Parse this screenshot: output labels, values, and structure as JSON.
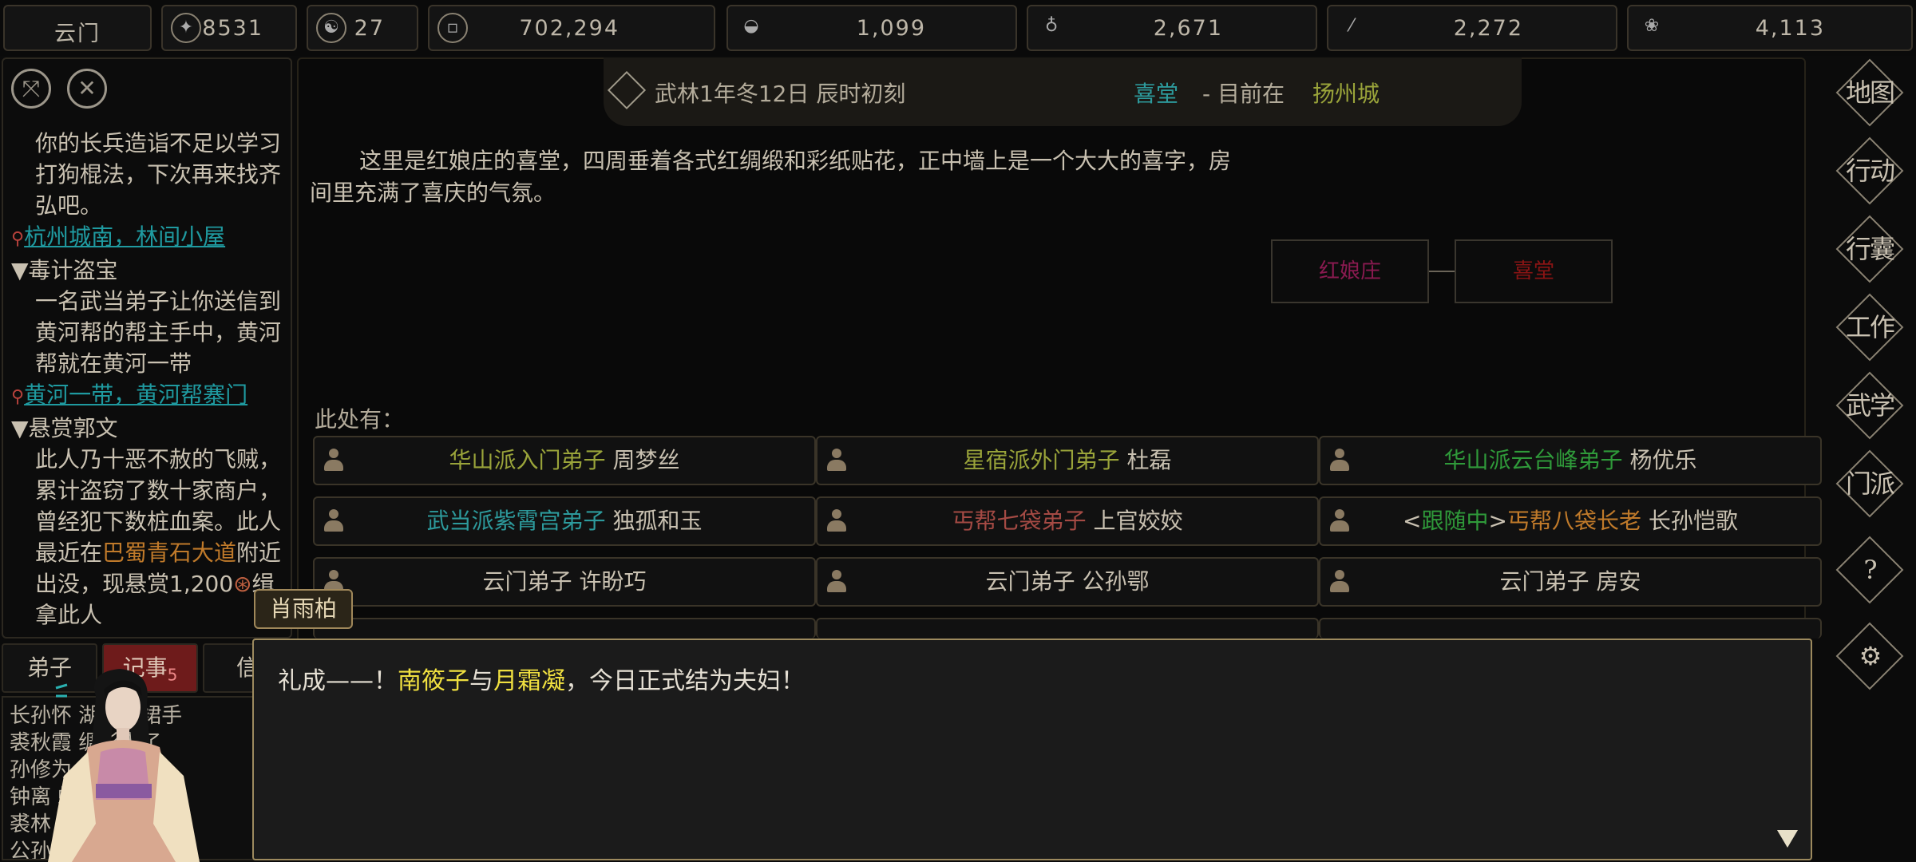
{
  "topbar": {
    "sect_name": "云门",
    "resources": [
      {
        "icon": "prestige-icon",
        "value": "8531"
      },
      {
        "icon": "yinyang-icon",
        "value": "27"
      },
      {
        "icon": "coin-icon",
        "value": "702,294"
      },
      {
        "icon": "food-bowl-icon",
        "value": "1,099"
      },
      {
        "icon": "gourd-icon",
        "value": "2,671"
      },
      {
        "icon": "wood-icon",
        "value": "2,272"
      },
      {
        "icon": "herb-icon",
        "value": "4,113"
      }
    ]
  },
  "quests": [
    {
      "title": "",
      "body": "你的长兵造诣不足以学习打狗棍法，下次再来找齐弘吧。",
      "location": "杭州城南，林间小屋"
    },
    {
      "title": "毒计盗宝",
      "body": "一名武当弟子让你送信到黄河帮的帮主手中，黄河帮就在黄河一带",
      "location": "黄河一带，黄河帮寨门"
    },
    {
      "title": "悬赏郭文",
      "body_a": "此人乃十恶不赦的飞贼，累计盗窃了数十家商户，曾经犯下数桩血案。此人最近在",
      "body_place": "巴蜀青石大道",
      "body_b": "附近出没，现悬赏1,200",
      "body_c": "缉拿此人"
    }
  ],
  "left_tabs": {
    "disciples": "弟子",
    "records": "记事",
    "records_badge": "5",
    "letters": "信"
  },
  "log_lines": [
    "长孙怀  湖绿长裙手",
    "裘秋霞  绸衫走了",
    "孙修为  衫走了过",
    "钟离    蟒袍走",
    "裘林    夹袄走",
    "公孙    小夹"
  ],
  "header": {
    "datetime": "武林1年冬12日 辰时初刻",
    "room": "喜堂",
    "sep": "- 目前在",
    "city": "扬州城"
  },
  "description": "这里是红娘庄的喜堂，四周垂着各式红绸缎和彩纸贴花，正中墙上是一个大大的喜字，房间里充满了喜庆的气氛。",
  "map": {
    "node1": "红娘庄",
    "node1_color": "#8a1a50",
    "node2": "喜堂",
    "node2_color": "#8a1414"
  },
  "here_label": "此处有：",
  "npcs": [
    {
      "title": "华山派入门弟子",
      "name": "周梦丝"
    },
    {
      "title": "星宿派外门弟子",
      "name": "杜磊"
    },
    {
      "title": "华山派云台峰弟子",
      "name": "杨优乐"
    },
    {
      "title": "武当派紫霄宫弟子",
      "name": "独孤和玉"
    },
    {
      "title": "丐帮七袋弟子",
      "name": "上官姣姣"
    },
    {
      "prefix_open": "<",
      "prefix": "跟随中",
      "prefix_close": ">",
      "title": "丐帮八袋长老",
      "name": "长孙恺歌"
    },
    {
      "title": "云门弟子",
      "name": "许盼巧"
    },
    {
      "title": "云门弟子",
      "name": "公孙鄂"
    },
    {
      "title": "云门弟子",
      "name": "房安"
    }
  ],
  "right_menu": [
    {
      "label": "地图",
      "icon": "map-icon"
    },
    {
      "label": "行动",
      "icon": "action-icon"
    },
    {
      "label": "行囊",
      "icon": "bag-icon"
    },
    {
      "label": "工作",
      "icon": "work-icon"
    },
    {
      "label": "武学",
      "icon": "martial-icon"
    },
    {
      "label": "门派",
      "icon": "sect-icon"
    },
    {
      "label": "?",
      "icon": "help-icon"
    },
    {
      "label": "⚙",
      "icon": "settings-icon"
    }
  ],
  "dialog": {
    "speaker": "肖雨柏",
    "text_a": "礼成——！",
    "name1": "南筱子",
    "text_b": "与",
    "name2": "月霜凝",
    "text_c": "，今日正式结为夫妇！"
  }
}
